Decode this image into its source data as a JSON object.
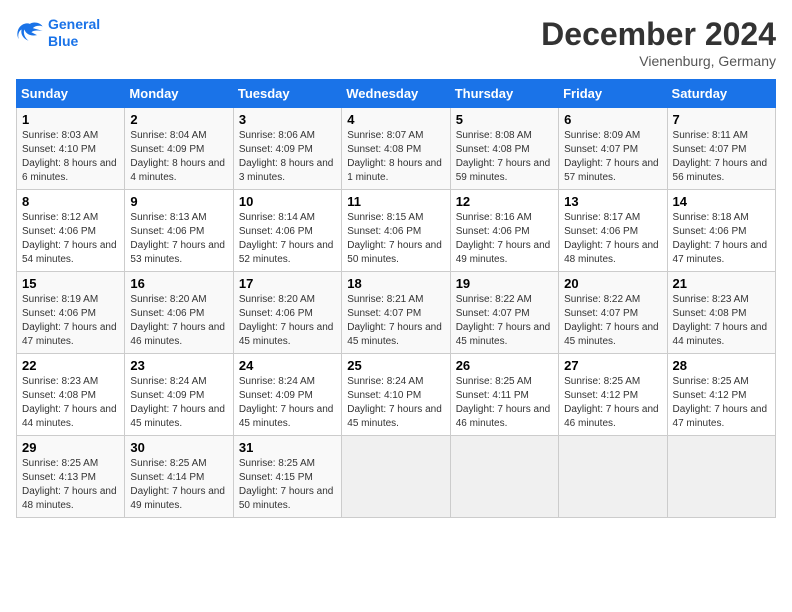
{
  "header": {
    "logo_line1": "General",
    "logo_line2": "Blue",
    "month": "December 2024",
    "location": "Vienenburg, Germany"
  },
  "days_of_week": [
    "Sunday",
    "Monday",
    "Tuesday",
    "Wednesday",
    "Thursday",
    "Friday",
    "Saturday"
  ],
  "weeks": [
    [
      {
        "day": "1",
        "sunrise": "Sunrise: 8:03 AM",
        "sunset": "Sunset: 4:10 PM",
        "daylight": "Daylight: 8 hours and 6 minutes."
      },
      {
        "day": "2",
        "sunrise": "Sunrise: 8:04 AM",
        "sunset": "Sunset: 4:09 PM",
        "daylight": "Daylight: 8 hours and 4 minutes."
      },
      {
        "day": "3",
        "sunrise": "Sunrise: 8:06 AM",
        "sunset": "Sunset: 4:09 PM",
        "daylight": "Daylight: 8 hours and 3 minutes."
      },
      {
        "day": "4",
        "sunrise": "Sunrise: 8:07 AM",
        "sunset": "Sunset: 4:08 PM",
        "daylight": "Daylight: 8 hours and 1 minute."
      },
      {
        "day": "5",
        "sunrise": "Sunrise: 8:08 AM",
        "sunset": "Sunset: 4:08 PM",
        "daylight": "Daylight: 7 hours and 59 minutes."
      },
      {
        "day": "6",
        "sunrise": "Sunrise: 8:09 AM",
        "sunset": "Sunset: 4:07 PM",
        "daylight": "Daylight: 7 hours and 57 minutes."
      },
      {
        "day": "7",
        "sunrise": "Sunrise: 8:11 AM",
        "sunset": "Sunset: 4:07 PM",
        "daylight": "Daylight: 7 hours and 56 minutes."
      }
    ],
    [
      {
        "day": "8",
        "sunrise": "Sunrise: 8:12 AM",
        "sunset": "Sunset: 4:06 PM",
        "daylight": "Daylight: 7 hours and 54 minutes."
      },
      {
        "day": "9",
        "sunrise": "Sunrise: 8:13 AM",
        "sunset": "Sunset: 4:06 PM",
        "daylight": "Daylight: 7 hours and 53 minutes."
      },
      {
        "day": "10",
        "sunrise": "Sunrise: 8:14 AM",
        "sunset": "Sunset: 4:06 PM",
        "daylight": "Daylight: 7 hours and 52 minutes."
      },
      {
        "day": "11",
        "sunrise": "Sunrise: 8:15 AM",
        "sunset": "Sunset: 4:06 PM",
        "daylight": "Daylight: 7 hours and 50 minutes."
      },
      {
        "day": "12",
        "sunrise": "Sunrise: 8:16 AM",
        "sunset": "Sunset: 4:06 PM",
        "daylight": "Daylight: 7 hours and 49 minutes."
      },
      {
        "day": "13",
        "sunrise": "Sunrise: 8:17 AM",
        "sunset": "Sunset: 4:06 PM",
        "daylight": "Daylight: 7 hours and 48 minutes."
      },
      {
        "day": "14",
        "sunrise": "Sunrise: 8:18 AM",
        "sunset": "Sunset: 4:06 PM",
        "daylight": "Daylight: 7 hours and 47 minutes."
      }
    ],
    [
      {
        "day": "15",
        "sunrise": "Sunrise: 8:19 AM",
        "sunset": "Sunset: 4:06 PM",
        "daylight": "Daylight: 7 hours and 47 minutes."
      },
      {
        "day": "16",
        "sunrise": "Sunrise: 8:20 AM",
        "sunset": "Sunset: 4:06 PM",
        "daylight": "Daylight: 7 hours and 46 minutes."
      },
      {
        "day": "17",
        "sunrise": "Sunrise: 8:20 AM",
        "sunset": "Sunset: 4:06 PM",
        "daylight": "Daylight: 7 hours and 45 minutes."
      },
      {
        "day": "18",
        "sunrise": "Sunrise: 8:21 AM",
        "sunset": "Sunset: 4:07 PM",
        "daylight": "Daylight: 7 hours and 45 minutes."
      },
      {
        "day": "19",
        "sunrise": "Sunrise: 8:22 AM",
        "sunset": "Sunset: 4:07 PM",
        "daylight": "Daylight: 7 hours and 45 minutes."
      },
      {
        "day": "20",
        "sunrise": "Sunrise: 8:22 AM",
        "sunset": "Sunset: 4:07 PM",
        "daylight": "Daylight: 7 hours and 45 minutes."
      },
      {
        "day": "21",
        "sunrise": "Sunrise: 8:23 AM",
        "sunset": "Sunset: 4:08 PM",
        "daylight": "Daylight: 7 hours and 44 minutes."
      }
    ],
    [
      {
        "day": "22",
        "sunrise": "Sunrise: 8:23 AM",
        "sunset": "Sunset: 4:08 PM",
        "daylight": "Daylight: 7 hours and 44 minutes."
      },
      {
        "day": "23",
        "sunrise": "Sunrise: 8:24 AM",
        "sunset": "Sunset: 4:09 PM",
        "daylight": "Daylight: 7 hours and 45 minutes."
      },
      {
        "day": "24",
        "sunrise": "Sunrise: 8:24 AM",
        "sunset": "Sunset: 4:09 PM",
        "daylight": "Daylight: 7 hours and 45 minutes."
      },
      {
        "day": "25",
        "sunrise": "Sunrise: 8:24 AM",
        "sunset": "Sunset: 4:10 PM",
        "daylight": "Daylight: 7 hours and 45 minutes."
      },
      {
        "day": "26",
        "sunrise": "Sunrise: 8:25 AM",
        "sunset": "Sunset: 4:11 PM",
        "daylight": "Daylight: 7 hours and 46 minutes."
      },
      {
        "day": "27",
        "sunrise": "Sunrise: 8:25 AM",
        "sunset": "Sunset: 4:12 PM",
        "daylight": "Daylight: 7 hours and 46 minutes."
      },
      {
        "day": "28",
        "sunrise": "Sunrise: 8:25 AM",
        "sunset": "Sunset: 4:12 PM",
        "daylight": "Daylight: 7 hours and 47 minutes."
      }
    ],
    [
      {
        "day": "29",
        "sunrise": "Sunrise: 8:25 AM",
        "sunset": "Sunset: 4:13 PM",
        "daylight": "Daylight: 7 hours and 48 minutes."
      },
      {
        "day": "30",
        "sunrise": "Sunrise: 8:25 AM",
        "sunset": "Sunset: 4:14 PM",
        "daylight": "Daylight: 7 hours and 49 minutes."
      },
      {
        "day": "31",
        "sunrise": "Sunrise: 8:25 AM",
        "sunset": "Sunset: 4:15 PM",
        "daylight": "Daylight: 7 hours and 50 minutes."
      },
      null,
      null,
      null,
      null
    ]
  ]
}
